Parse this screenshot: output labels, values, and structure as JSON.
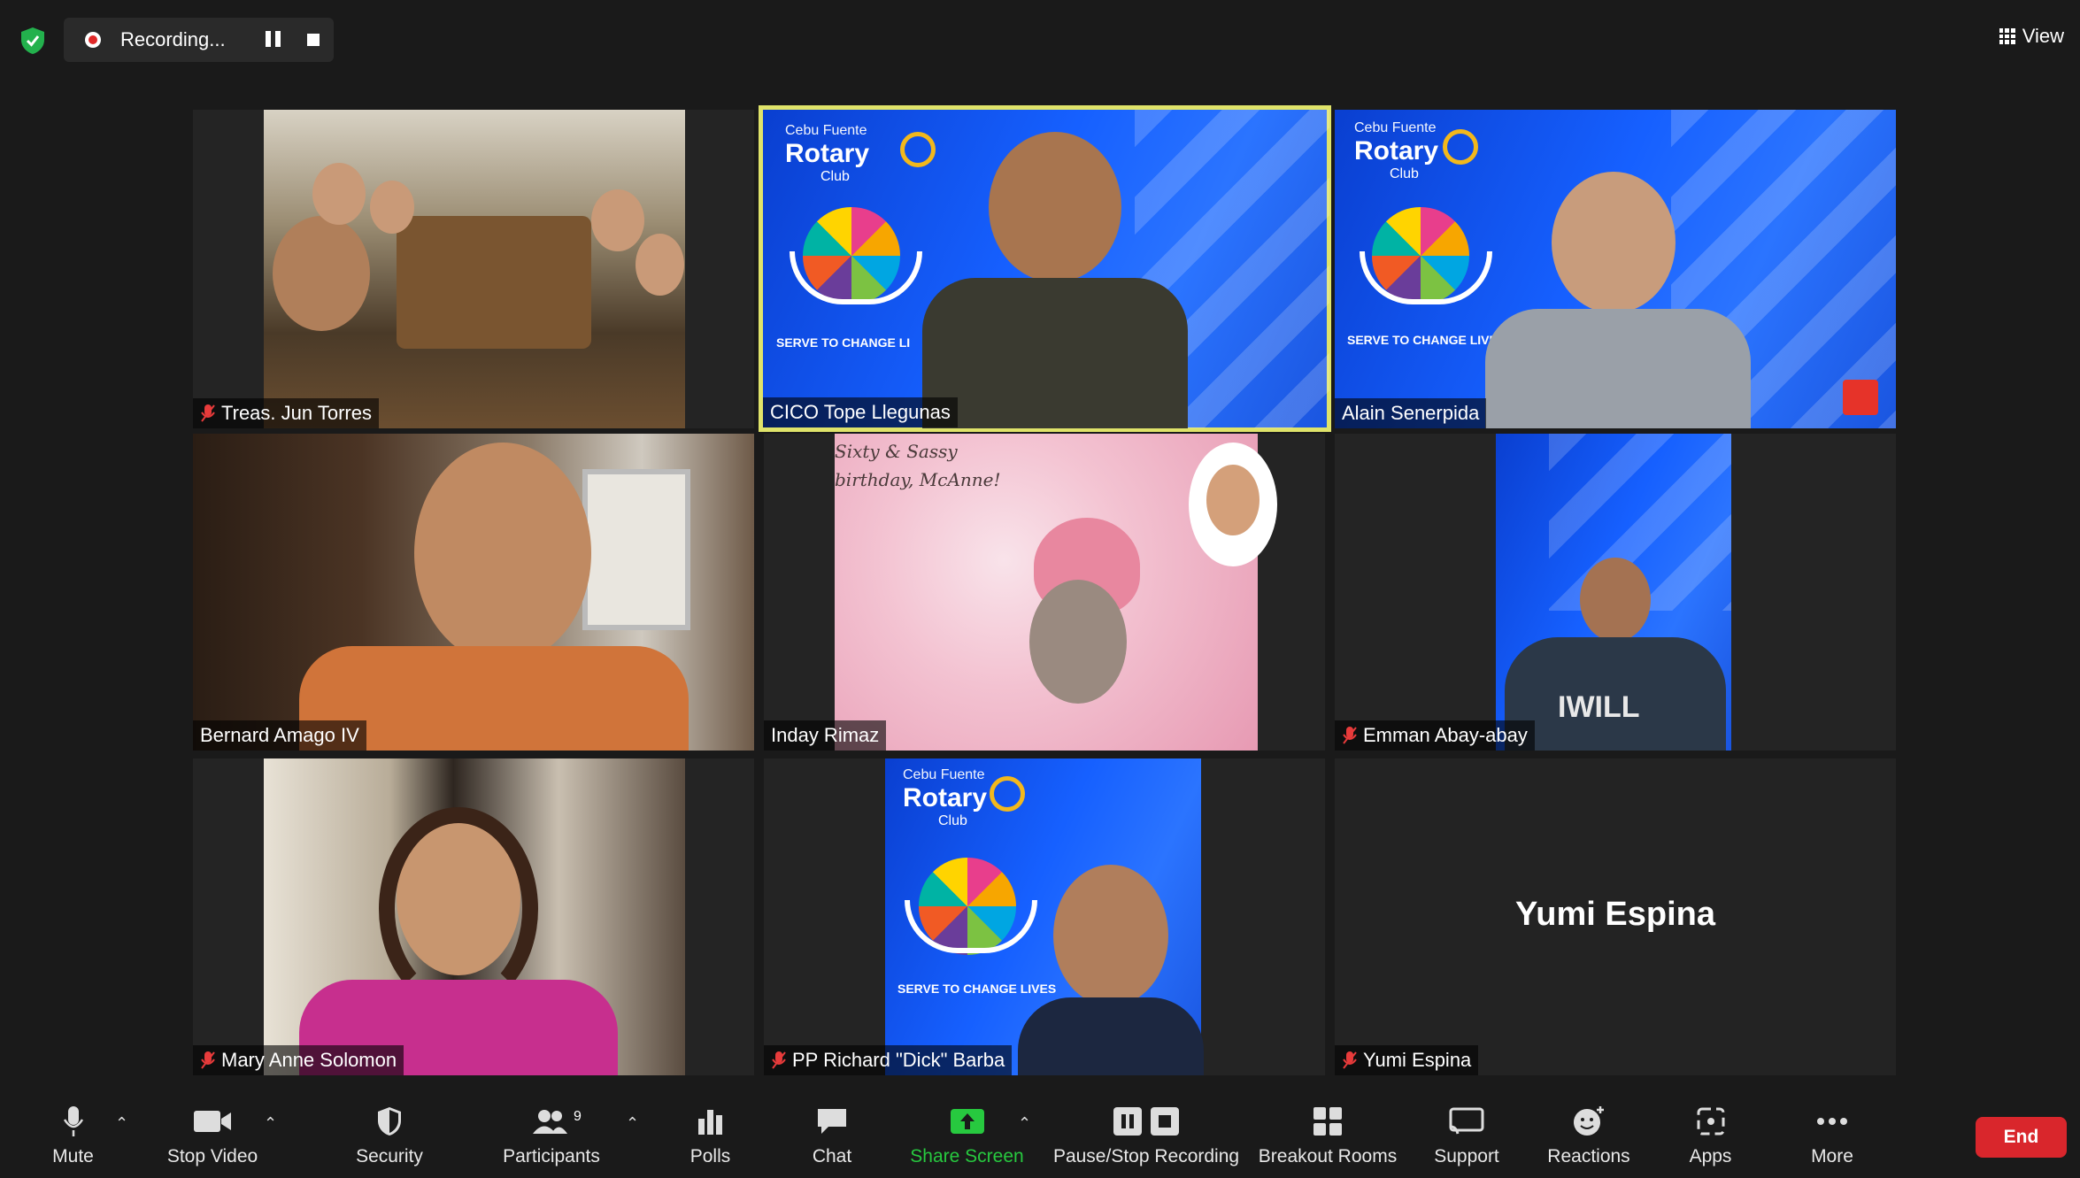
{
  "topbar": {
    "recording_label": "Recording...",
    "view_label": "View"
  },
  "tiles": [
    {
      "name": "Treas. Jun Torres",
      "muted": true
    },
    {
      "name": "CICO Tope Llegunas",
      "muted": false,
      "active_speaker": true
    },
    {
      "name": "Alain Senerpida",
      "muted": false
    },
    {
      "name": "Bernard Amago IV",
      "muted": false
    },
    {
      "name": "Inday Rimaz",
      "muted": false
    },
    {
      "name": "Emman Abay-abay",
      "muted": true
    },
    {
      "name": "Mary Anne Solomon",
      "muted": true
    },
    {
      "name": "PP Richard \"Dick\" Barba",
      "muted": true
    },
    {
      "name": "Yumi Espina",
      "muted": true,
      "video_off": true,
      "center_name": "Yumi Espina"
    }
  ],
  "background_text": {
    "club_line1": "Cebu Fuente",
    "club_line2": "Rotary",
    "club_line3": "Club",
    "serve": "SERVE TO CHANGE LIVES",
    "serve_cut": "SERVE TO CHANGE LI",
    "card_line1": "Sixty & Sassy",
    "card_line2": "birthday, McAnne!",
    "shirt": "IWILL"
  },
  "toolbar": {
    "mute": "Mute",
    "stop_video": "Stop Video",
    "security": "Security",
    "participants": "Participants",
    "participants_count": "9",
    "polls": "Polls",
    "chat": "Chat",
    "share_screen": "Share Screen",
    "recording": "Pause/Stop Recording",
    "breakout": "Breakout Rooms",
    "support": "Support",
    "reactions": "Reactions",
    "apps": "Apps",
    "more": "More",
    "end": "End"
  },
  "colors": {
    "active_border": "#dfe36a",
    "share_green": "#27c93f",
    "end_red": "#d9262c",
    "rotary_blue": "#1660ff"
  }
}
